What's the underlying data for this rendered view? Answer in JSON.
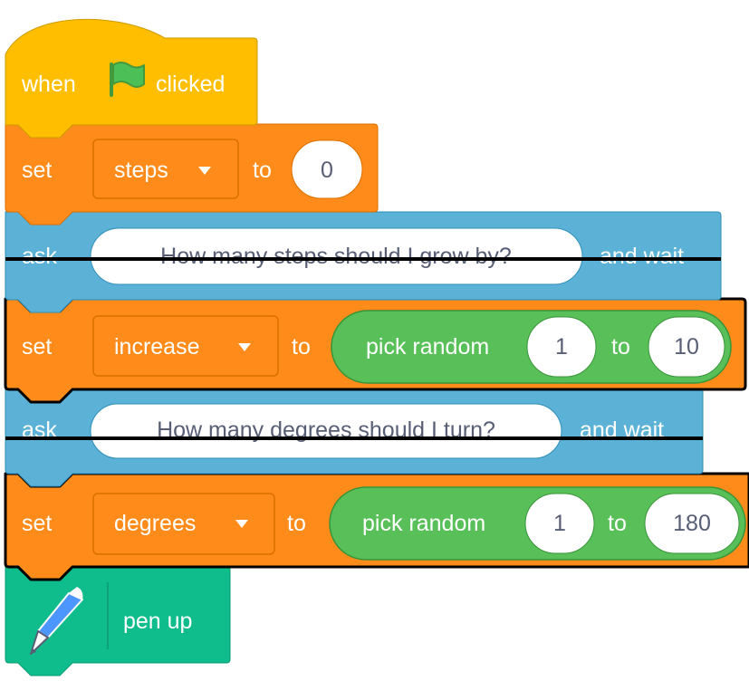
{
  "script": {
    "hat": {
      "when": "when",
      "clicked": "clicked",
      "icon": "green-flag-icon"
    },
    "set_steps": {
      "label": "set",
      "variable": "steps",
      "to": "to",
      "value": "0"
    },
    "ask_steps": {
      "label": "ask",
      "question": "How many steps should I grow by?",
      "and_wait": "and wait"
    },
    "set_increase": {
      "label": "set",
      "variable": "increase",
      "to": "to",
      "reporter": {
        "label": "pick random",
        "from": "1",
        "to": "to",
        "max": "10"
      }
    },
    "ask_degrees": {
      "label": "ask",
      "question": "How many degrees should I turn?",
      "and_wait": "and wait"
    },
    "set_degrees": {
      "label": "set",
      "variable": "degrees",
      "to": "to",
      "reporter": {
        "label": "pick random",
        "from": "1",
        "to": "to",
        "max": "180"
      }
    },
    "pen_up": {
      "label": "pen up",
      "icon": "pen-icon"
    }
  },
  "colors": {
    "events": "#ffbf00",
    "variables": "#ff8c1a",
    "sensing": "#5cb1d6",
    "operators": "#59c059",
    "pen": "#0fbd8c",
    "variables_dark": "#db6e00",
    "sensing_dark": "#2e8eb8",
    "operators_dark": "#389438",
    "selected_outline": "#000000"
  }
}
